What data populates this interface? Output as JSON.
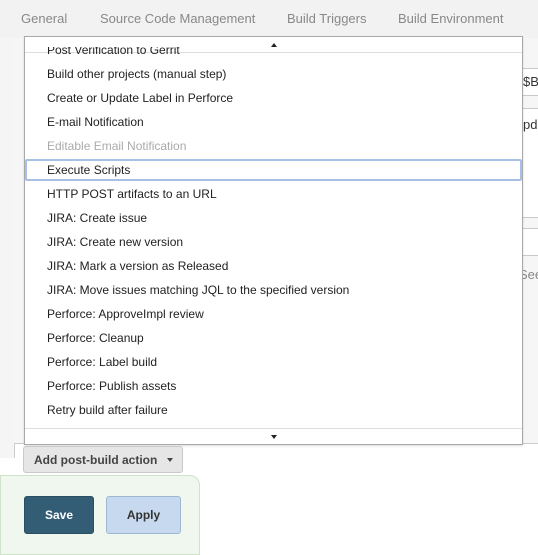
{
  "tabs": [
    {
      "label": "General"
    },
    {
      "label": "Source Code Management"
    },
    {
      "label": "Build Triggers"
    },
    {
      "label": "Build Environment"
    }
  ],
  "background": {
    "fragment_1": "$B",
    "fragment_2": "pd",
    "fragment_3": "See"
  },
  "post_build_menu": {
    "items": [
      {
        "label": "Post Verification to Gerrit",
        "state": "normal"
      },
      {
        "label": "Build other projects (manual step)",
        "state": "normal"
      },
      {
        "label": "Create or Update Label in Perforce",
        "state": "normal"
      },
      {
        "label": "E-mail Notification",
        "state": "normal"
      },
      {
        "label": "Editable Email Notification",
        "state": "disabled"
      },
      {
        "label": "Execute Scripts",
        "state": "selected"
      },
      {
        "label": "HTTP POST artifacts to an URL",
        "state": "normal"
      },
      {
        "label": "JIRA: Create issue",
        "state": "normal"
      },
      {
        "label": "JIRA: Create new version",
        "state": "normal"
      },
      {
        "label": "JIRA: Mark a version as Released",
        "state": "normal"
      },
      {
        "label": "JIRA: Move issues matching JQL to the specified version",
        "state": "normal"
      },
      {
        "label": "Perforce: ApproveImpl review",
        "state": "normal"
      },
      {
        "label": "Perforce: Cleanup",
        "state": "normal"
      },
      {
        "label": "Perforce: Label build",
        "state": "normal"
      },
      {
        "label": "Perforce: Publish assets",
        "state": "normal"
      },
      {
        "label": "Retry build after failure",
        "state": "normal"
      }
    ]
  },
  "add_post_build_action": {
    "label": "Add post-build action"
  },
  "footer": {
    "save_label": "Save",
    "apply_label": "Apply"
  },
  "colors": {
    "save_bg": "#335d74",
    "apply_bg": "#c7d9ee",
    "selection_border": "#a8c0e6"
  },
  "icons": {
    "scroll_up": "triangle-up-icon",
    "scroll_down": "triangle-down-icon",
    "dropdown_caret": "caret-down-icon"
  }
}
